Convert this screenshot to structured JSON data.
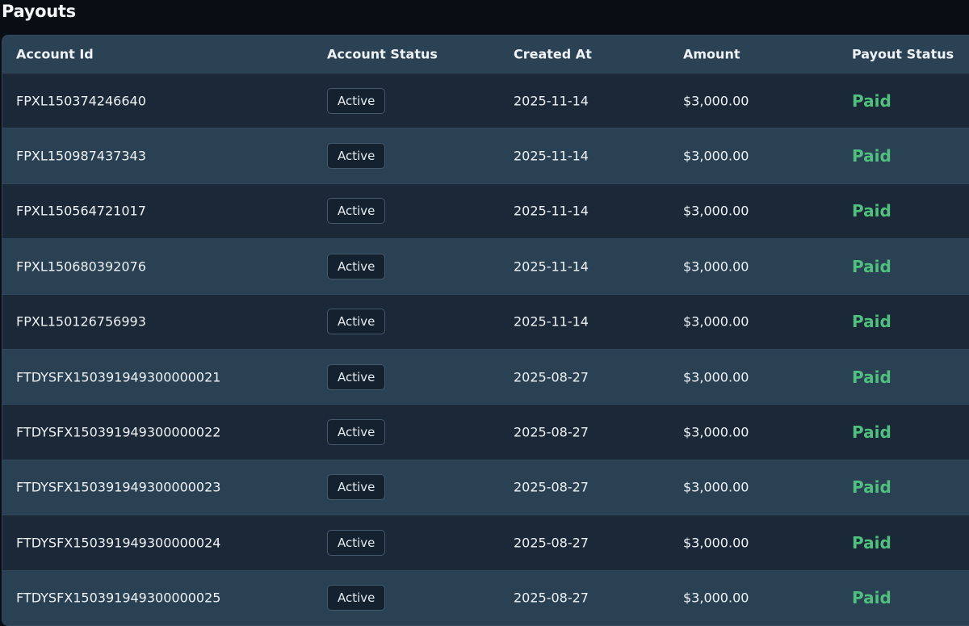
{
  "page": {
    "title": "Payouts"
  },
  "table": {
    "headers": [
      "Account Id",
      "Account Status",
      "Created At",
      "Amount",
      "Payout Status"
    ],
    "rows": [
      {
        "account_id": "FPXL150374246640",
        "account_status": "Active",
        "created_at": "2025-11-14",
        "amount": "$3,000.00",
        "payout_status": "Paid"
      },
      {
        "account_id": "FPXL150987437343",
        "account_status": "Active",
        "created_at": "2025-11-14",
        "amount": "$3,000.00",
        "payout_status": "Paid"
      },
      {
        "account_id": "FPXL150564721017",
        "account_status": "Active",
        "created_at": "2025-11-14",
        "amount": "$3,000.00",
        "payout_status": "Paid"
      },
      {
        "account_id": "FPXL150680392076",
        "account_status": "Active",
        "created_at": "2025-11-14",
        "amount": "$3,000.00",
        "payout_status": "Paid"
      },
      {
        "account_id": "FPXL150126756993",
        "account_status": "Active",
        "created_at": "2025-11-14",
        "amount": "$3,000.00",
        "payout_status": "Paid"
      },
      {
        "account_id": "FTDYSFX150391949300000021",
        "account_status": "Active",
        "created_at": "2025-08-27",
        "amount": "$3,000.00",
        "payout_status": "Paid"
      },
      {
        "account_id": "FTDYSFX150391949300000022",
        "account_status": "Active",
        "created_at": "2025-08-27",
        "amount": "$3,000.00",
        "payout_status": "Paid"
      },
      {
        "account_id": "FTDYSFX150391949300000023",
        "account_status": "Active",
        "created_at": "2025-08-27",
        "amount": "$3,000.00",
        "payout_status": "Paid"
      },
      {
        "account_id": "FTDYSFX150391949300000024",
        "account_status": "Active",
        "created_at": "2025-08-27",
        "amount": "$3,000.00",
        "payout_status": "Paid"
      },
      {
        "account_id": "FTDYSFX150391949300000025",
        "account_status": "Active",
        "created_at": "2025-08-27",
        "amount": "$3,000.00",
        "payout_status": "Paid"
      }
    ]
  },
  "colors": {
    "background": "#090e14",
    "header_bg": "#2b4154",
    "row_dark": "#1a2837",
    "row_light": "#2a4154",
    "paid_green": "#4fc07d"
  }
}
